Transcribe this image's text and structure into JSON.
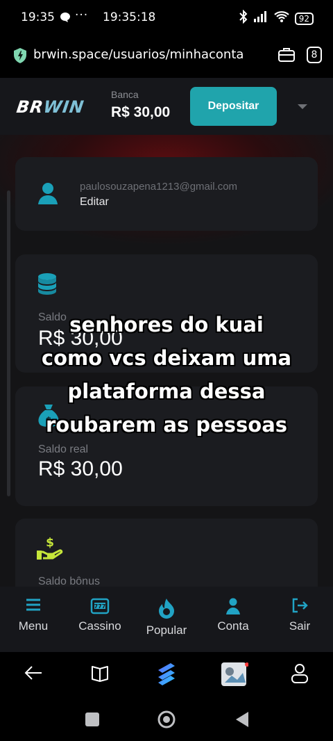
{
  "status_bar": {
    "time": "19:35",
    "dots": "···",
    "clock": "19:35:18",
    "battery": "92"
  },
  "browser": {
    "url": "brwin.space/usuarios/minhaconta",
    "tab_count": "8"
  },
  "header": {
    "logo_main": "BR",
    "logo_accent": "WIN",
    "bank_label": "Banca",
    "bank_value": "R$  30,00",
    "deposit_label": "Depositar"
  },
  "profile": {
    "email": "paulosouzapena1213@gmail.com",
    "edit_label": "Editar"
  },
  "balance": {
    "label": "Saldo",
    "value": "R$ 30,00"
  },
  "real_balance": {
    "label": "Saldo real",
    "value": "R$ 30,00"
  },
  "bonus_balance": {
    "label": "Saldo bônus"
  },
  "caption": {
    "lines": [
      "senhores do kuai",
      "como vcs deixam uma",
      "plataforma dessa",
      "roubarem as pessoas"
    ]
  },
  "nav": {
    "items": [
      {
        "label": "Menu",
        "icon": "menu-icon"
      },
      {
        "label": "Cassino",
        "icon": "slot-machine-icon"
      },
      {
        "label": "Popular",
        "icon": "flame-icon"
      },
      {
        "label": "Conta",
        "icon": "user-icon"
      },
      {
        "label": "Sair",
        "icon": "logout-icon"
      }
    ]
  },
  "colors": {
    "accent": "#20a4ac",
    "nav_icon": "#21a3c4",
    "coin": "#1aa0b8",
    "bonus_icon": "#c6e63a"
  }
}
